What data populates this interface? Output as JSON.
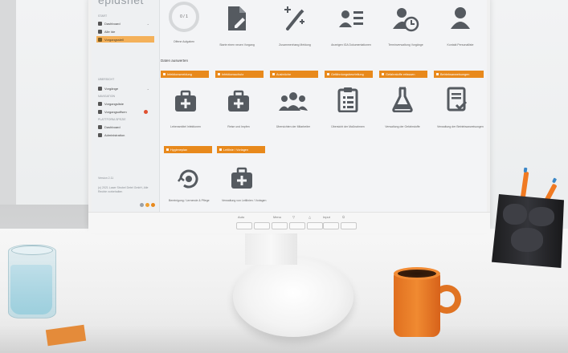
{
  "app": {
    "brand": "epidsnet"
  },
  "sidebar": {
    "section_start": "START",
    "items_top": [
      {
        "label": "Dashboard",
        "active": false,
        "icon": "calendar-icon"
      },
      {
        "label": "Alle Ide",
        "active": false,
        "icon": "grid-icon"
      },
      {
        "label": "Vorgangsstell",
        "active": true,
        "icon": "folder-icon"
      }
    ],
    "section_ubersicht": "ÜBERSICHT",
    "item_vorgange": "Vorgänge",
    "section_navigation": "NAVIGATION",
    "items_nav": [
      {
        "label": "Vorgangsliste",
        "icon": "list-icon"
      },
      {
        "label": "Vorgangsoffsen",
        "icon": "pin-icon",
        "badge": true
      }
    ],
    "section_plattform": "PLATTFORM-SPEZIE",
    "items_platform": [
      {
        "label": "Dashboard",
        "icon": "chart-icon"
      },
      {
        "label": "Administration",
        "icon": "users-icon"
      }
    ],
    "footer_version": "Version 2.11",
    "footer_copy": "(c) 2021 Laser Strobel Detel GmbH, Alle Rechte vorbehalten",
    "dot_colors": [
      "#9aa0a6",
      "#f0a030",
      "#e8891c"
    ]
  },
  "main": {
    "top_tiles": [
      {
        "label": "Offene Aufgaben",
        "icon": "progress-ring-icon",
        "value": "0 / 1"
      },
      {
        "label": "Starte einen neuen Vorgang",
        "icon": "edit-document-icon"
      },
      {
        "label": "Zusammenhang Meldung",
        "icon": "wand-icon"
      },
      {
        "label": "Anzeigen IGA Dokumentationen",
        "icon": "person-list-icon"
      },
      {
        "label": "Terminverwaltung Vorgänge",
        "icon": "person-clock-icon"
      },
      {
        "label": "Kontakt Personalliste",
        "icon": "person-icon"
      }
    ],
    "section_title": "Daten auswerten",
    "chips_row1": [
      "Infektionsmeldung",
      "Infektionsschutz",
      "Ausbrüche",
      "Gefährdungsbeurteilung",
      "Gefahrstoffe erfassen",
      "Betriebsanweisungen"
    ],
    "tiles_row2": [
      {
        "label": "Lebensmittel Infektionen",
        "icon": "medkit-icon"
      },
      {
        "label": "Reise und Impfen",
        "icon": "medkit-icon"
      },
      {
        "label": "Übersichten der Mitarbeiter",
        "icon": "group-icon"
      },
      {
        "label": "Übersicht der Maßnahmen",
        "icon": "clipboard-list-icon"
      },
      {
        "label": "Verwaltung der Gefahrstoffe",
        "icon": "flask-icon"
      },
      {
        "label": "Verwaltung der Betriebsanweisungen",
        "icon": "document-check-icon"
      }
    ],
    "chips_row2": [
      "Hygieneplan",
      "Leitlinie / Vorlagen"
    ],
    "tiles_row3": [
      {
        "label": "Bereinigung / Lernende & Pflege",
        "icon": "refresh-gear-icon"
      },
      {
        "label": "Verwaltung von Leitlinien / Vorlagen",
        "icon": "medkit-icon"
      }
    ]
  },
  "monitor_buttons": [
    "Auto",
    "",
    "Menu",
    "▽",
    "△",
    "Input",
    "⏻"
  ],
  "colors": {
    "accent": "#e8891c",
    "sidebar_active": "#f4b15a",
    "icon": "#555a60"
  }
}
